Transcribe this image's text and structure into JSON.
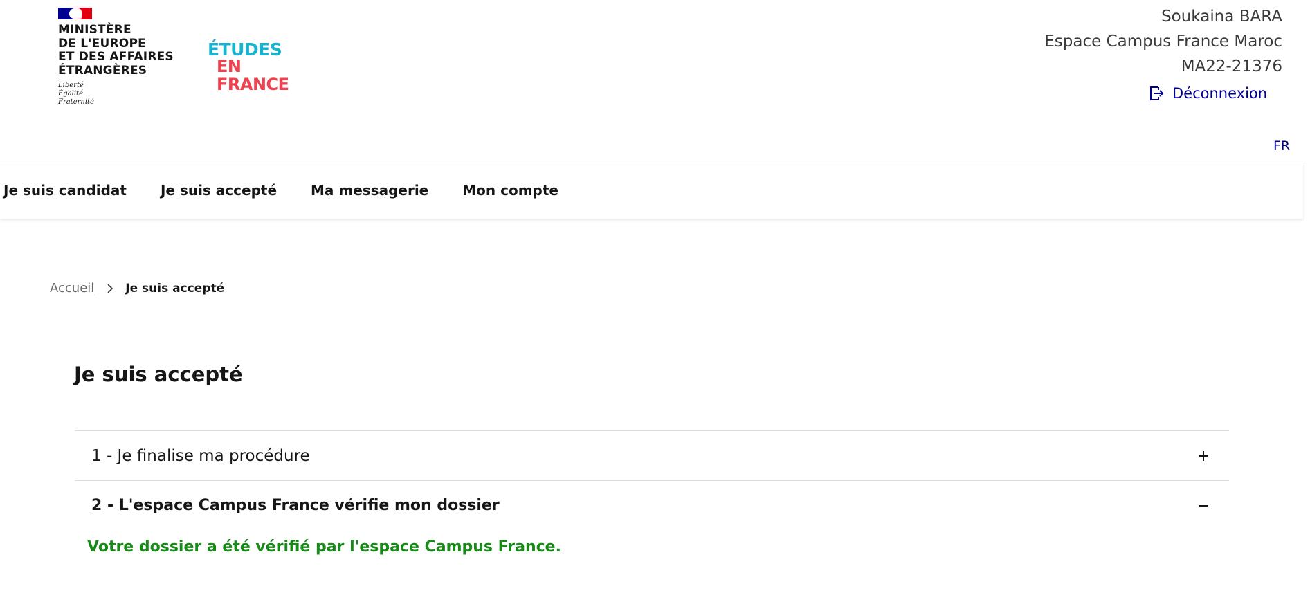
{
  "header": {
    "ministry_lines": [
      "MINISTÈRE",
      "DE L'EUROPE",
      "ET DES AFFAIRES",
      "ÉTRANGÈRES"
    ],
    "devise_lines": [
      "Liberté",
      "Égalité",
      "Fraternité"
    ],
    "logo_top": "ÉTUDES",
    "logo_bottom": "EN FRANCE",
    "user_name": "Soukaina BARA",
    "espace": "Espace Campus France Maroc",
    "dossier_id": "MA22-21376",
    "logout_label": "Déconnexion",
    "language": "FR"
  },
  "nav": {
    "items": [
      {
        "label": "Je suis candidat"
      },
      {
        "label": "Je suis accepté"
      },
      {
        "label": "Ma messagerie"
      },
      {
        "label": "Mon compte"
      }
    ]
  },
  "breadcrumb": {
    "home": "Accueil",
    "current": "Je suis accepté"
  },
  "page": {
    "title": "Je suis accepté"
  },
  "accordion": {
    "items": [
      {
        "title": "1 - Je finalise ma procédure",
        "expanded": false,
        "toggle_icon": "plus-icon"
      },
      {
        "title": "2 - L'espace Campus France vérifie mon dossier",
        "expanded": true,
        "toggle_icon": "minus-icon"
      }
    ],
    "verified_message": "Votre dossier a été vérifié par l'espace Campus France."
  },
  "colors": {
    "accent_blue": "#000091",
    "success_green": "#188a18",
    "etudes_cyan": "#19b3d0",
    "etudes_red": "#ef4250"
  }
}
